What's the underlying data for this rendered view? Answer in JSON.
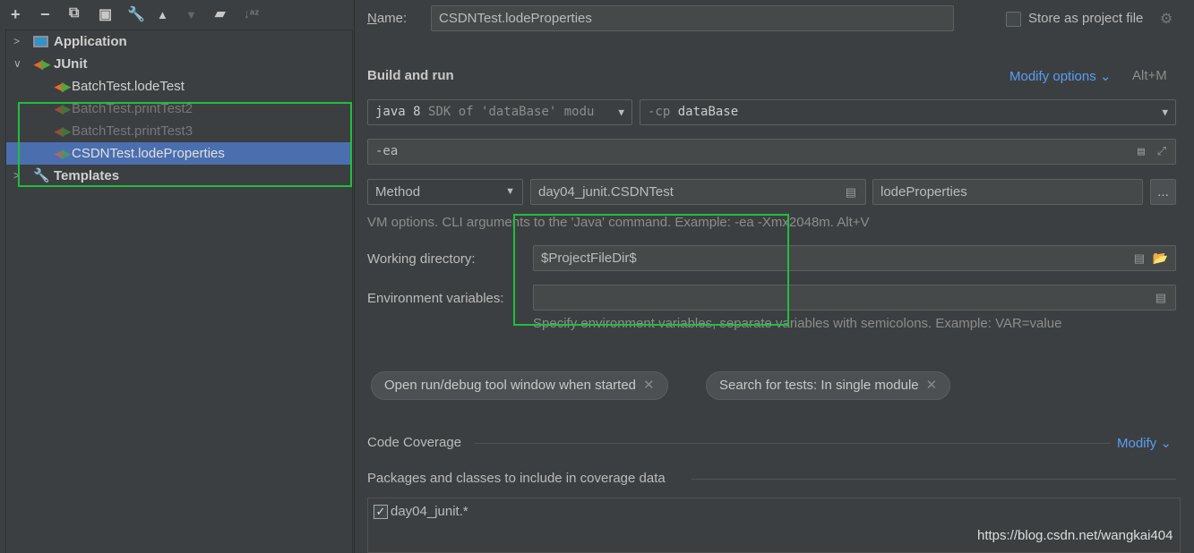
{
  "toolbar": {
    "icons": [
      "plus-icon",
      "minus-icon",
      "copy-icon",
      "save-icon",
      "wrench-icon",
      "arrow-up-icon",
      "arrow-down-icon",
      "new-folder-icon",
      "sort-icon"
    ],
    "glyphs": [
      "+",
      "−",
      "⧉",
      "🖫",
      "🔧",
      "▲",
      "▼",
      "📁",
      "↓ᵃᶻ"
    ]
  },
  "tree": {
    "application": "Application",
    "junit": "JUnit",
    "items": [
      {
        "label": "BatchTest.lodeTest"
      },
      {
        "label": "BatchTest.printTest2"
      },
      {
        "label": "BatchTest.printTest3"
      },
      {
        "label": "CSDNTest.lodeProperties"
      }
    ],
    "templates": "Templates"
  },
  "form": {
    "name_label": "Name:",
    "name_value": "CSDNTest.lodeProperties",
    "store_label": "Store as project file",
    "build_run": "Build and run",
    "modify_options": "Modify options",
    "modify_shortcut": "Alt+M",
    "jdk_main": "java 8",
    "jdk_hint": "SDK of 'dataBase' modu",
    "cp_prefix": "-cp",
    "cp_value": "dataBase",
    "vm_value": "-ea",
    "test_kind": "Method",
    "test_class": "day04_junit.CSDNTest",
    "test_method": "lodeProperties",
    "more": "...",
    "vm_hint": "VM options. CLI arguments to the 'Java' command. Example: -ea -Xmx2048m. Alt+V",
    "workdir_label": "Working directory:",
    "workdir_value": "$ProjectFileDir$",
    "env_label": "Environment variables:",
    "env_value": "",
    "env_hint": "Specify environment variables, separate variables with semicolons. Example: VAR=value",
    "chips": [
      "Open run/debug tool window when started",
      "Search for tests: In single module"
    ],
    "coverage": "Code Coverage",
    "coverage_modify": "Modify",
    "packages_label": "Packages and classes to include in coverage data",
    "package_item": "day04_junit.*"
  },
  "watermark": "https://blog.csdn.net/wangkai404",
  "colors": {
    "background": "#3c3f41",
    "selection": "#4b6eaf",
    "link": "#589df6",
    "annotation": "#1fbf3c"
  }
}
